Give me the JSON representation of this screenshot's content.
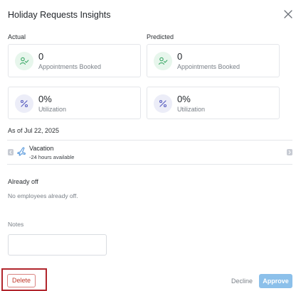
{
  "dialog": {
    "title": "Holiday Requests Insights"
  },
  "actual": {
    "label": "Actual",
    "appointments": {
      "value": "0",
      "label": "Appointments Booked"
    },
    "utilization": {
      "value": "0%",
      "label": "Utilization"
    }
  },
  "predicted": {
    "label": "Predicted",
    "appointments": {
      "value": "0",
      "label": "Appointments Booked"
    },
    "utilization": {
      "value": "0%",
      "label": "Utilization"
    }
  },
  "as_of": "As of Jul 22, 2025",
  "leave_type": {
    "name": "Vacation",
    "available": "-24 hours available",
    "icon": "airplane-icon"
  },
  "already_off": {
    "label": "Already off",
    "empty_text": "No employees already off."
  },
  "notes": {
    "label": "Notes",
    "value": ""
  },
  "actions": {
    "delete_label": "Delete",
    "decline_label": "Decline",
    "approve_label": "Approve"
  },
  "colors": {
    "success_icon_bg": "#e7f6ec",
    "utilization_icon_bg": "#ecedf8",
    "approve_bg": "#8cc0ea",
    "delete_text": "#c0392b",
    "highlight_frame": "#b1252c"
  }
}
